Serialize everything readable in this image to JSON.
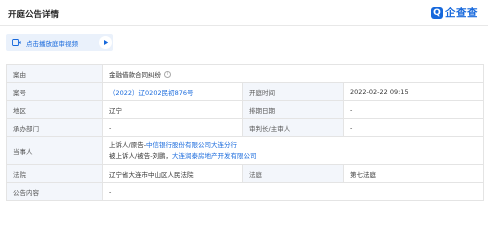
{
  "header": {
    "title": "开庭公告详情",
    "logo_mark": "Q",
    "logo_text": "企查查"
  },
  "video": {
    "label": "点击播放庭审视频"
  },
  "rows": {
    "case_reason": {
      "label": "案由",
      "value": "金融借款合同纠纷"
    },
    "case_no": {
      "label": "案号",
      "value": "（2022）辽0202民初876号",
      "label2": "开庭时间",
      "value2": "2022-02-22 09:15"
    },
    "region": {
      "label": "地区",
      "value": "辽宁",
      "label2": "排期日期",
      "value2": "-"
    },
    "dept": {
      "label": "承办部门",
      "value": "-",
      "label2": "审判长/主审人",
      "value2": "-"
    },
    "parties": {
      "label": "当事人",
      "plaintiff_prefix": "上诉人/原告-",
      "plaintiff_name": "中信银行股份有限公司大连分行",
      "defendant_prefix": "被上诉人/被告-刘鹏，",
      "defendant_name": "大连润泰房地产开发有限公司"
    },
    "court": {
      "label": "法院",
      "value": "辽宁省大连市中山区人民法院",
      "label2": "法庭",
      "value2": "第七法庭"
    },
    "content": {
      "label": "公告内容",
      "value": "-"
    }
  }
}
